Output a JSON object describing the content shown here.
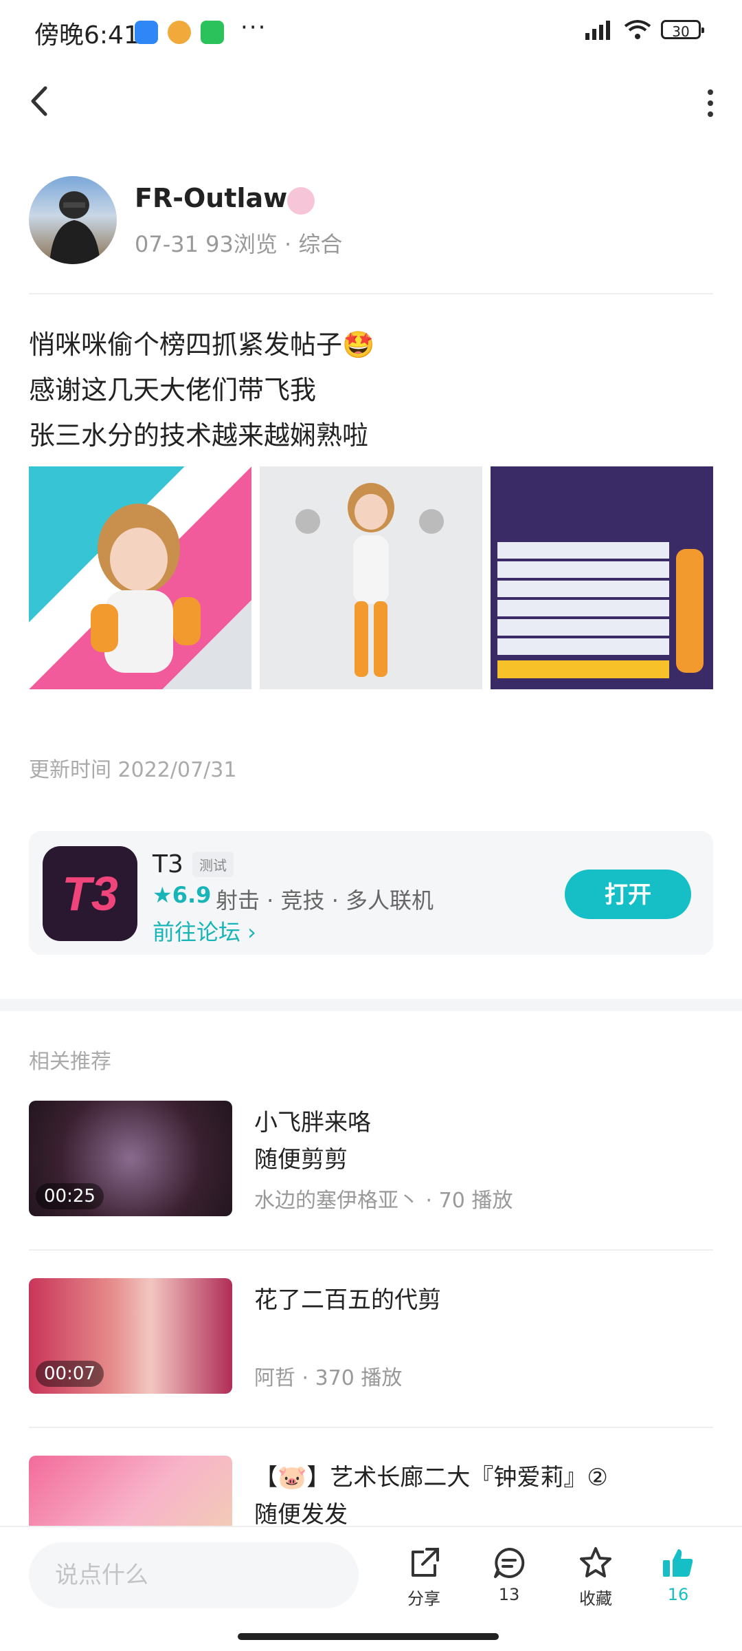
{
  "status_bar": {
    "time": "傍晚6:41",
    "dots": "···",
    "battery": "30"
  },
  "nav": {},
  "author": {
    "name": "FR-Outlaws",
    "meta": "07-31 93浏览 · 综合"
  },
  "post": {
    "lines": [
      "悄咪咪偷个榜四抓紧发帖子🤩",
      "感谢这几天大佬们带飞我",
      "张三水分的技术越来越娴熟啦"
    ]
  },
  "update_time": "更新时间 2022/07/31",
  "game": {
    "title": "T3",
    "tag": "测试",
    "rating": "★6.9",
    "genres": "射击 · 竞技 · 多人联机",
    "forum": "前往论坛 ›",
    "open_label": "打开",
    "logo_text": "T3"
  },
  "related": {
    "title": "相关推荐",
    "items": [
      {
        "duration": "00:25",
        "title1": "小飞胖来咯",
        "title2": "随便剪剪",
        "meta": "水边的塞伊格亚丶 · 70 播放"
      },
      {
        "duration": "00:07",
        "title1": "花了二百五的代剪",
        "title2": "",
        "meta": "阿哲 · 370 播放"
      },
      {
        "duration": "",
        "title1": "【🐷】艺术长廊二大『钟爱莉』②",
        "title2": "随便发发",
        "meta": ""
      }
    ]
  },
  "bottom_bar": {
    "placeholder": "说点什么",
    "share_label": "分享",
    "comment_count": "13",
    "favorite_label": "收藏",
    "like_count": "16"
  },
  "colors": {
    "accent": "#16bfc5",
    "like": "#16bfc5"
  }
}
